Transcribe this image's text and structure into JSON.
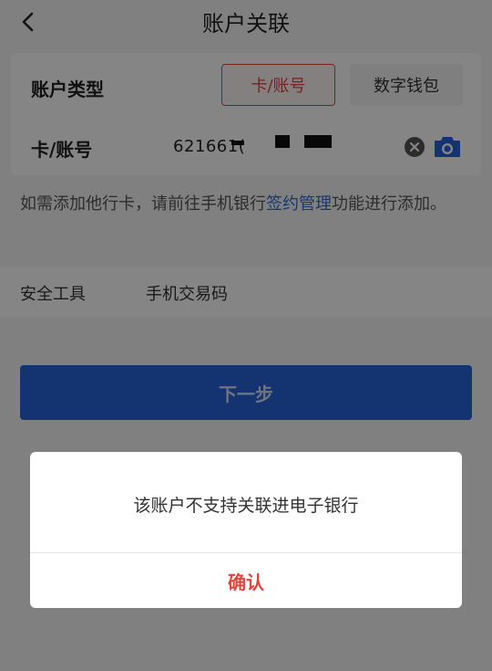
{
  "header": {
    "title": "账户关联"
  },
  "form": {
    "account_type_label": "账户类型",
    "account_type_options": {
      "card": "卡/账号",
      "wallet": "数字钱包"
    },
    "card_label": "卡/账号",
    "card_number": "621661("
  },
  "tip": {
    "before": "如需添加他行卡，请前往手机银行",
    "link": "签约管理",
    "after": "功能进行添加。"
  },
  "security": {
    "label": "安全工具",
    "value": "手机交易码"
  },
  "next_button": "下一步",
  "dialog": {
    "message": "该账户不支持关联进电子银行",
    "confirm": "确认"
  },
  "colors": {
    "accent_red": "#e0443c",
    "primary_blue": "#2862d8",
    "link_blue": "#2d6cd8"
  },
  "icons": {
    "back": "back-icon",
    "clear": "clear-icon",
    "camera": "camera-icon"
  }
}
